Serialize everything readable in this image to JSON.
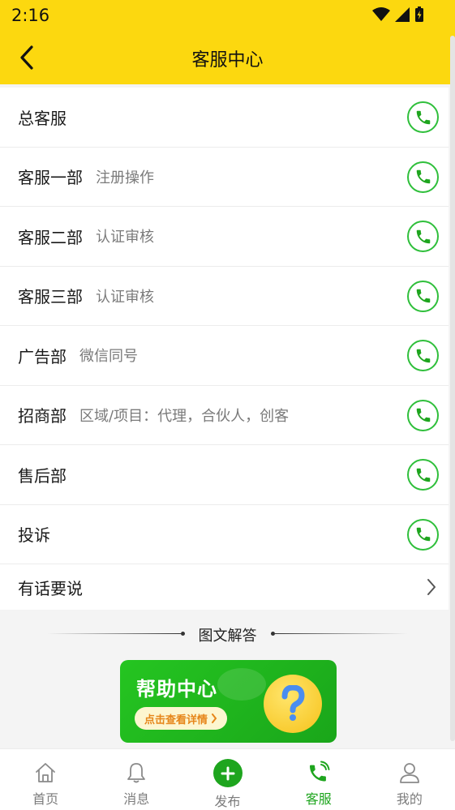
{
  "status": {
    "time": "2:16"
  },
  "header": {
    "title": "客服中心"
  },
  "contacts": [
    {
      "title": "总客服",
      "sub": ""
    },
    {
      "title": "客服一部",
      "sub": "注册操作"
    },
    {
      "title": "客服二部",
      "sub": "认证审核"
    },
    {
      "title": "客服三部",
      "sub": "认证审核"
    },
    {
      "title": "广告部",
      "sub": "微信同号"
    },
    {
      "title": "招商部",
      "sub": "区域/项目：代理，合伙人，创客"
    },
    {
      "title": "售后部",
      "sub": ""
    },
    {
      "title": "投诉",
      "sub": ""
    }
  ],
  "feedback": {
    "label": "有话要说"
  },
  "section": {
    "title": "图文解答"
  },
  "help_banner": {
    "title": "帮助中心",
    "cta": "点击查看详情"
  },
  "nav": [
    {
      "label": "首页",
      "icon": "home-icon"
    },
    {
      "label": "消息",
      "icon": "bell-icon"
    },
    {
      "label": "发布",
      "icon": "plus-icon"
    },
    {
      "label": "客服",
      "icon": "phone-service-icon",
      "active": true
    },
    {
      "label": "我的",
      "icon": "person-icon"
    }
  ],
  "colors": {
    "brand_yellow": "#fcd80f",
    "accent_green": "#1ea51e"
  }
}
